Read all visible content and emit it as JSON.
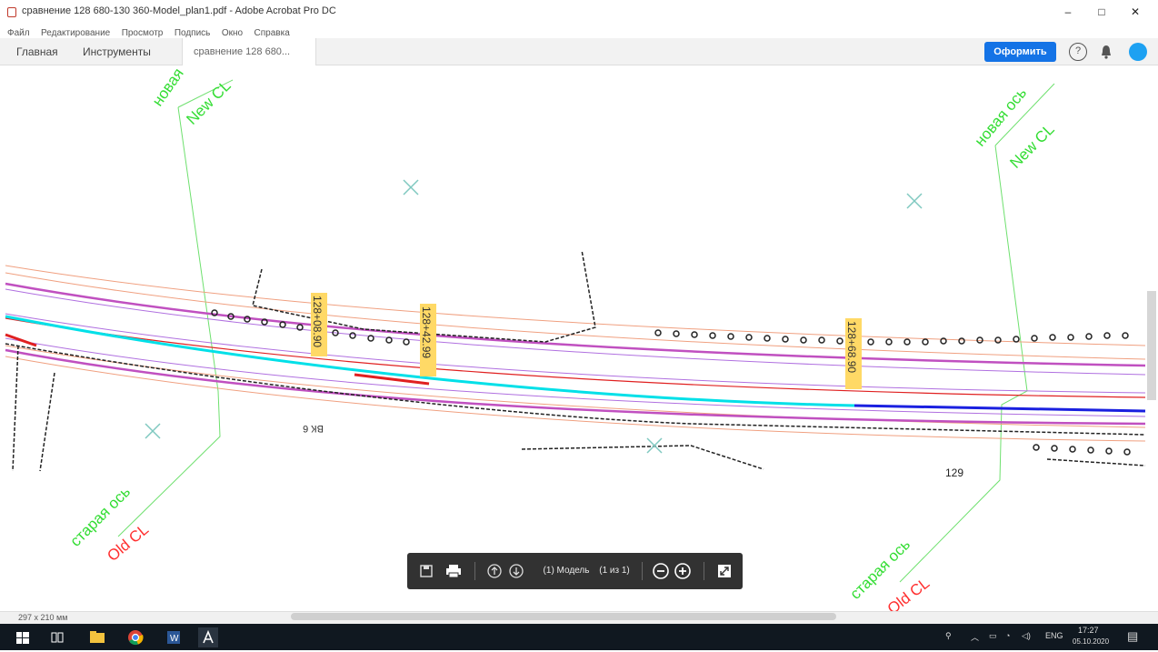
{
  "window": {
    "title": "сравнение 128 680-130 360-Model_plan1.pdf - Adobe Acrobat Pro DC",
    "minimize": "–",
    "maximize": "□",
    "close": "✕"
  },
  "menu": [
    "Файл",
    "Редактирование",
    "Просмотр",
    "Подпись",
    "Окно",
    "Справка"
  ],
  "tabs": {
    "home": "Главная",
    "tools": "Инструменты",
    "document": "сравнение 128 680...",
    "document_close": "×"
  },
  "header": {
    "share_button": "Оформить",
    "help_icon": "?",
    "bell_icon": "bell-icon",
    "avatar_color": "#1da1f2"
  },
  "drawing": {
    "labels_new_left": [
      "новая",
      "New CL"
    ],
    "labels_new_right": [
      "новая ось",
      "New CL"
    ],
    "labels_old_left": [
      "старая ось",
      "Old CL"
    ],
    "labels_old_right": [
      "старая ось",
      "Old CL"
    ],
    "stations": [
      "128+08.90",
      "128+42.99",
      "128+68.90"
    ],
    "number_129": "129",
    "note_vk": "ВК 6",
    "colors": {
      "new_label": "#33dd33",
      "old_label": "#ff3030",
      "cyan_line": "#00e0e8",
      "blue_line": "#1a20e0",
      "magenta_line": "#c050c0",
      "red_line": "#e02020",
      "station_tag": "#ffd966"
    }
  },
  "floating_toolbar": {
    "page_info": "(1) Модель",
    "page_count": "(1 из 1)"
  },
  "status": {
    "page_size": "297 x 210 мм"
  },
  "taskbar": {
    "language": "ENG",
    "time": "17:27",
    "date": "05.10.2020"
  }
}
